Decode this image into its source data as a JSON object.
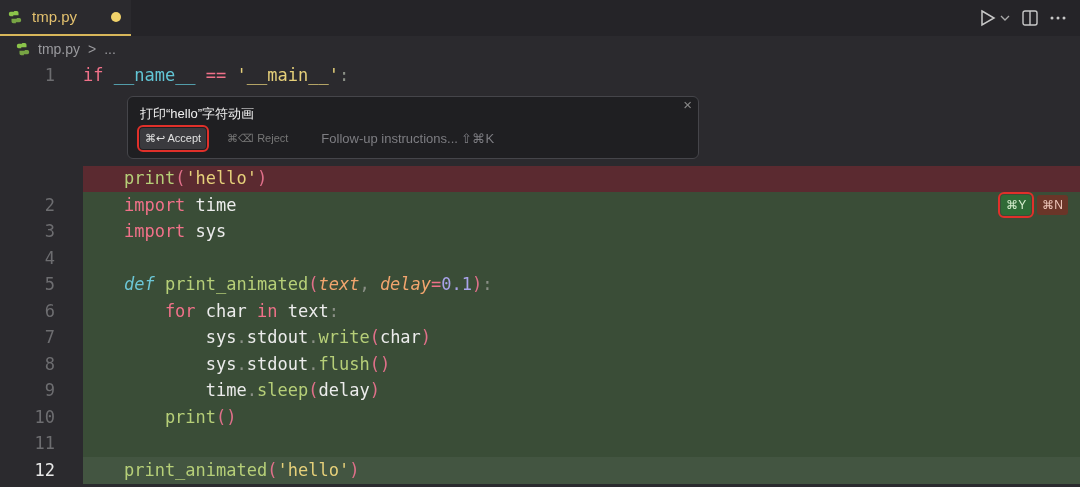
{
  "tab": {
    "label": "tmp.py",
    "modified": true,
    "selected": true
  },
  "breadcrumb": {
    "file": "tmp.py",
    "separator": ">",
    "more": "..."
  },
  "lines": [
    {
      "number": "1",
      "kind": "normal",
      "current": false,
      "tokens": [
        {
          "text": "if",
          "kind": "kw"
        },
        {
          "text": " __name__",
          "kind": "dunder"
        },
        {
          "text": " ==",
          "kind": "op"
        },
        {
          "text": " '__main__'",
          "kind": "str"
        },
        {
          "text": ":",
          "kind": "punct"
        }
      ]
    },
    {
      "kind": "widget"
    },
    {
      "kind": "deleted",
      "current": false,
      "tokens": [
        {
          "text": "    print",
          "kind": "fn"
        },
        {
          "text": "(",
          "kind": "paren"
        },
        {
          "text": "'hello'",
          "kind": "str"
        },
        {
          "text": ")",
          "kind": "paren"
        }
      ]
    },
    {
      "number": "2",
      "kind": "added",
      "current": false,
      "tokens": [
        {
          "text": "    import",
          "kind": "kw"
        },
        {
          "text": " time",
          "kind": "plain"
        }
      ]
    },
    {
      "number": "3",
      "kind": "added",
      "current": false,
      "tokens": [
        {
          "text": "    import",
          "kind": "kw"
        },
        {
          "text": " sys",
          "kind": "plain"
        }
      ]
    },
    {
      "number": "4",
      "kind": "added",
      "current": false
    },
    {
      "number": "5",
      "kind": "added",
      "current": false,
      "tokens": [
        {
          "text": "    def",
          "kind": "def"
        },
        {
          "text": " print_animated",
          "kind": "fn"
        },
        {
          "text": "(",
          "kind": "paren"
        },
        {
          "text": "text",
          "kind": "param"
        },
        {
          "text": ",",
          "kind": "punct"
        },
        {
          "text": " delay",
          "kind": "param"
        },
        {
          "text": "=",
          "kind": "op"
        },
        {
          "text": "0.1",
          "kind": "num"
        },
        {
          "text": ")",
          "kind": "paren"
        },
        {
          "text": ":",
          "kind": "punct"
        }
      ]
    },
    {
      "number": "6",
      "kind": "added",
      "current": false,
      "tokens": [
        {
          "text": "        for",
          "kind": "kw"
        },
        {
          "text": " char",
          "kind": "plain"
        },
        {
          "text": " in",
          "kind": "kw"
        },
        {
          "text": " text",
          "kind": "plain"
        },
        {
          "text": ":",
          "kind": "punct"
        }
      ]
    },
    {
      "number": "7",
      "kind": "added",
      "current": false,
      "tokens": [
        {
          "text": "            sys",
          "kind": "plain"
        },
        {
          "text": ".",
          "kind": "punct"
        },
        {
          "text": "stdout",
          "kind": "plain"
        },
        {
          "text": ".",
          "kind": "punct"
        },
        {
          "text": "write",
          "kind": "fn"
        },
        {
          "text": "(",
          "kind": "paren"
        },
        {
          "text": "char",
          "kind": "plain"
        },
        {
          "text": ")",
          "kind": "paren"
        }
      ]
    },
    {
      "number": "8",
      "kind": "added",
      "current": false,
      "tokens": [
        {
          "text": "            sys",
          "kind": "plain"
        },
        {
          "text": ".",
          "kind": "punct"
        },
        {
          "text": "stdout",
          "kind": "plain"
        },
        {
          "text": ".",
          "kind": "punct"
        },
        {
          "text": "flush",
          "kind": "fn"
        },
        {
          "text": "()",
          "kind": "paren"
        }
      ]
    },
    {
      "number": "9",
      "kind": "added",
      "current": false,
      "tokens": [
        {
          "text": "            time",
          "kind": "plain"
        },
        {
          "text": ".",
          "kind": "punct"
        },
        {
          "text": "sleep",
          "kind": "fn"
        },
        {
          "text": "(",
          "kind": "paren"
        },
        {
          "text": "delay",
          "kind": "plain"
        },
        {
          "text": ")",
          "kind": "paren"
        }
      ]
    },
    {
      "number": "10",
      "kind": "added",
      "current": false,
      "tokens": [
        {
          "text": "        print",
          "kind": "fn"
        },
        {
          "text": "()",
          "kind": "paren"
        }
      ]
    },
    {
      "number": "11",
      "kind": "added",
      "current": false
    },
    {
      "number": "12",
      "kind": "added",
      "current": true,
      "tokens": [
        {
          "text": "    print_animated",
          "kind": "fn"
        },
        {
          "text": "(",
          "kind": "paren"
        },
        {
          "text": "'hello'",
          "kind": "str"
        },
        {
          "text": ")",
          "kind": "paren"
        }
      ]
    }
  ],
  "prompt": {
    "text": "打印“hello”字符动画",
    "close": "×",
    "actions": [
      {
        "label": "⌘↩ Accept",
        "kind": "accept",
        "highlighted": true
      },
      {
        "label": "⌘⌫ Reject",
        "kind": "reject",
        "highlighted": false
      }
    ],
    "followup": "Follow-up instructions... ⇧⌘K"
  },
  "diff_badges": [
    {
      "label": "⌘Y",
      "kind": "accept",
      "highlighted": true
    },
    {
      "label": "⌘N",
      "kind": "reject",
      "highlighted": false
    }
  ]
}
